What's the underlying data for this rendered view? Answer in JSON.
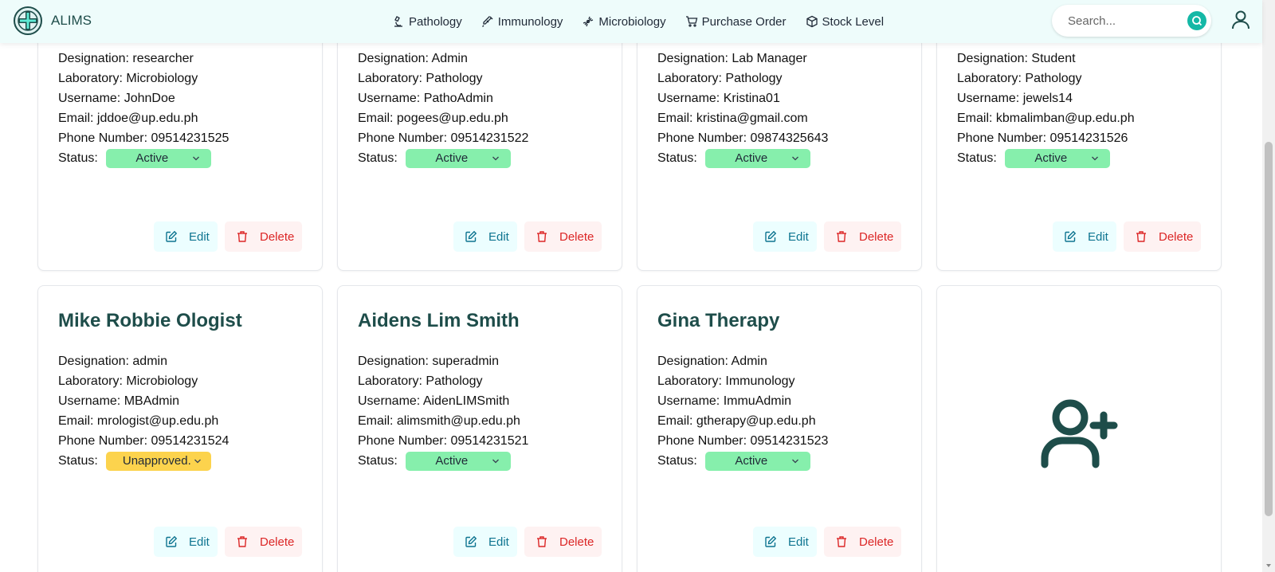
{
  "app": {
    "name": "ALIMS"
  },
  "nav": [
    {
      "label": "Pathology",
      "icon": "microscope-icon"
    },
    {
      "label": "Immunology",
      "icon": "syringe-icon"
    },
    {
      "label": "Microbiology",
      "icon": "bacteria-icon"
    },
    {
      "label": "Purchase Order",
      "icon": "cart-icon"
    },
    {
      "label": "Stock Level",
      "icon": "box-icon"
    }
  ],
  "search": {
    "placeholder": "Search..."
  },
  "labels": {
    "designation": "Designation: ",
    "laboratory": "Laboratory: ",
    "username": "Username: ",
    "email": "Email: ",
    "phone": "Phone Number: ",
    "status": "Status:",
    "edit": "Edit",
    "delete": "Delete"
  },
  "users": [
    {
      "name": "",
      "designation": "researcher",
      "laboratory": "Microbiology",
      "username": "JohnDoe",
      "email": "jddoe@up.edu.ph",
      "phone": "09514231525",
      "status": "Active"
    },
    {
      "name": "",
      "designation": "Admin",
      "laboratory": "Pathology",
      "username": "PathoAdmin",
      "email": "pogees@up.edu.ph",
      "phone": "09514231522",
      "status": "Active"
    },
    {
      "name": "",
      "designation": "Lab Manager",
      "laboratory": "Pathology",
      "username": "Kristina01",
      "email": "kristina@gmail.com",
      "phone": "09874325643",
      "status": "Active"
    },
    {
      "name": "",
      "designation": "Student",
      "laboratory": "Pathology",
      "username": "jewels14",
      "email": "kbmalimban@up.edu.ph",
      "phone": "09514231526",
      "status": "Active"
    },
    {
      "name": "Mike Robbie Ologist",
      "designation": "admin",
      "laboratory": "Microbiology",
      "username": "MBAdmin",
      "email": "mrologist@up.edu.ph",
      "phone": "09514231524",
      "status": "Unapproved."
    },
    {
      "name": "Aidens Lim Smith",
      "designation": "superadmin",
      "laboratory": "Pathology",
      "username": "AidenLIMSmith",
      "email": "alimsmith@up.edu.ph",
      "phone": "09514231521",
      "status": "Active"
    },
    {
      "name": "Gina Therapy",
      "designation": "Admin",
      "laboratory": "Immunology",
      "username": "ImmuAdmin",
      "email": "gtherapy@up.edu.ph",
      "phone": "09514231523",
      "status": "Active"
    }
  ],
  "colors": {
    "active": "#86efac",
    "unapproved": "#fcd34d",
    "accent": "#14b8a6",
    "brand": "#1e4d4a"
  }
}
